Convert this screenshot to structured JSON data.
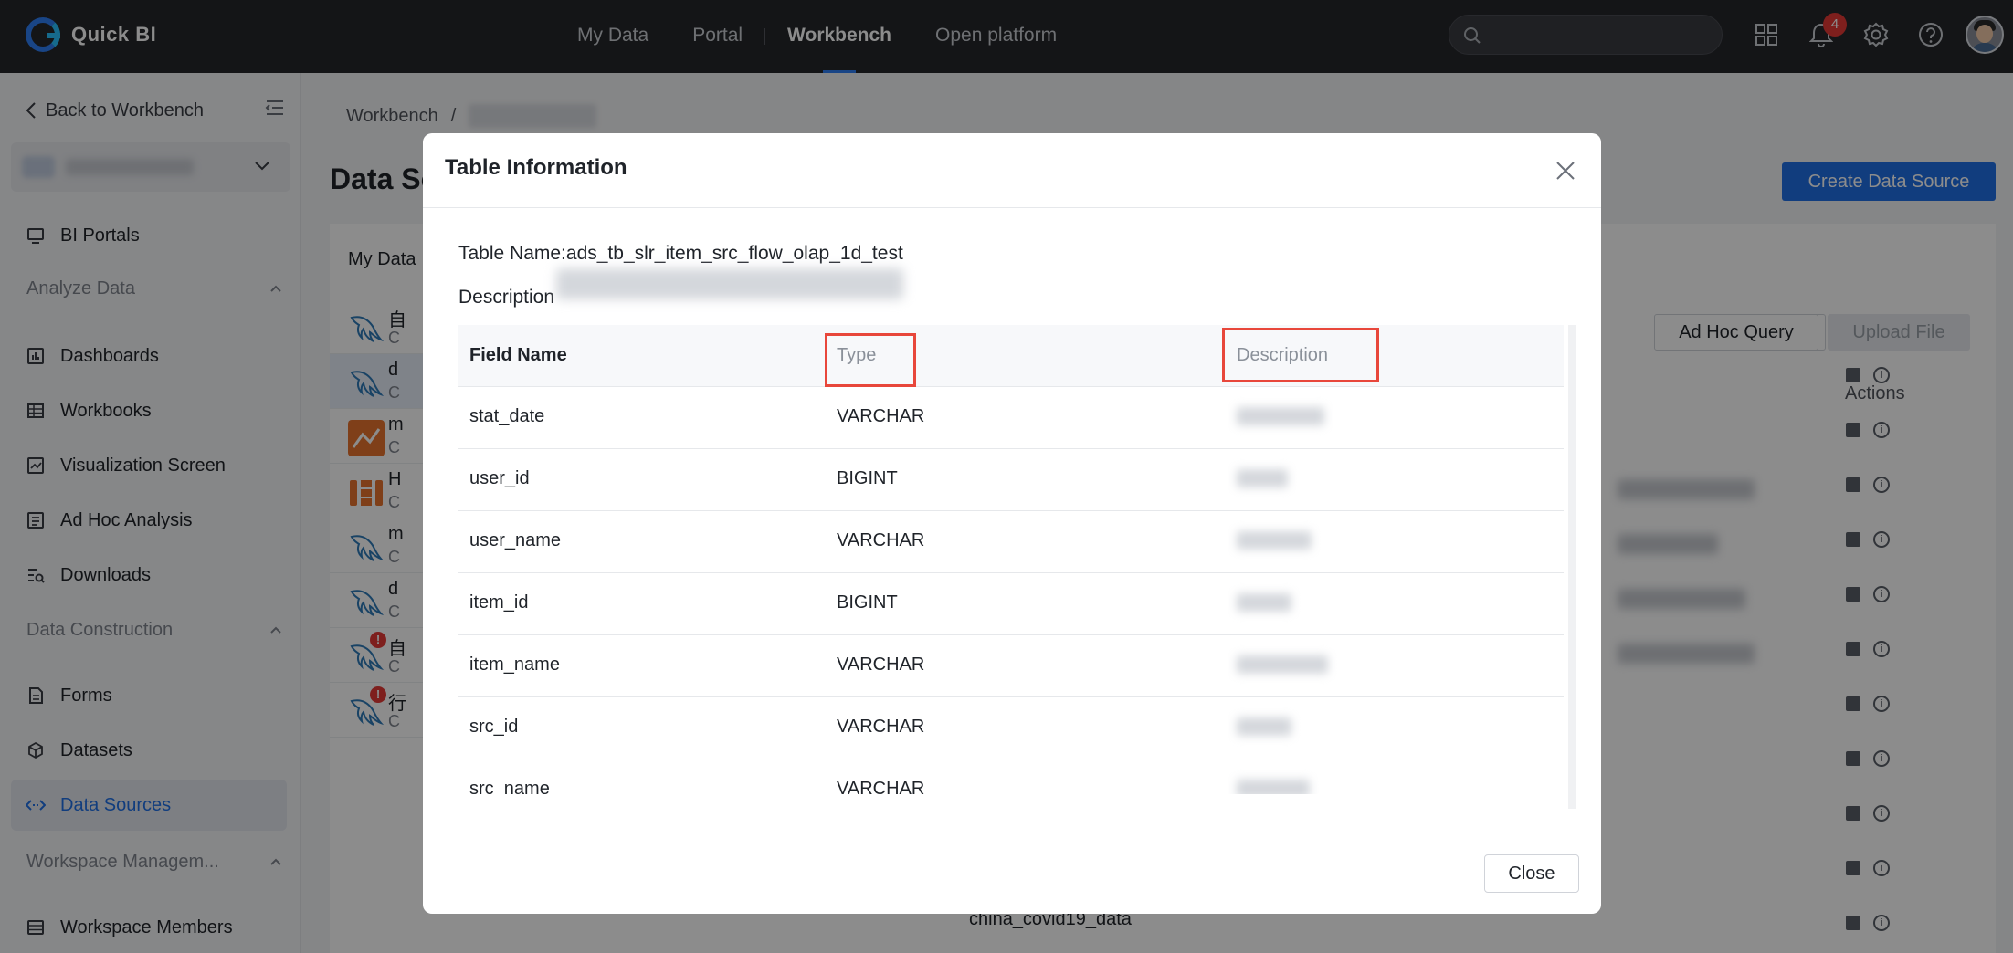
{
  "topbar": {
    "app_name": "Quick BI",
    "nav": [
      "My Data",
      "Portal",
      "Workbench",
      "Open platform"
    ],
    "active_nav": "Workbench",
    "notifications_count": "4",
    "accent_color": "#2f7ef5"
  },
  "sidebar": {
    "back_label": "Back to Workbench",
    "items": {
      "bi_portals": "BI Portals",
      "analyze_group": "Analyze Data",
      "dashboards": "Dashboards",
      "workbooks": "Workbooks",
      "visualization_screen": "Visualization Screen",
      "ad_hoc_analysis": "Ad Hoc Analysis",
      "downloads": "Downloads",
      "construction_group": "Data Construction",
      "forms": "Forms",
      "datasets": "Datasets",
      "data_sources": "Data Sources",
      "workspace_group": "Workspace Managem...",
      "workspace_members": "Workspace Members"
    }
  },
  "page": {
    "breadcrumb_root": "Workbench",
    "breadcrumb_sep": "/",
    "title": "Data So",
    "create_button": "Create Data Source",
    "tab_mydata": "My Data",
    "ad_hoc_query": "Ad Hoc Query",
    "upload_file": "Upload File",
    "actions_header": "Actions",
    "sources": [
      {
        "name": "自",
        "sub": "C"
      },
      {
        "name": "d",
        "sub": "C"
      },
      {
        "name": "m",
        "sub": "C"
      },
      {
        "name": "H",
        "sub": "C"
      },
      {
        "name": "m",
        "sub": "C"
      },
      {
        "name": "d",
        "sub": "C"
      },
      {
        "name": "自",
        "sub": "C"
      },
      {
        "name": "行",
        "sub": "C"
      }
    ],
    "last_table_name": "china_covid19_data"
  },
  "modal": {
    "title": "Table Information",
    "table_name_line": "Table Name:ads_tb_slr_item_src_flow_olap_1d_test",
    "description_label": "Description",
    "columns": {
      "field_name": "Field Name",
      "type": "Type",
      "description": "Description"
    },
    "rows": [
      {
        "field": "stat_date",
        "type": "VARCHAR"
      },
      {
        "field": "user_id",
        "type": "BIGINT"
      },
      {
        "field": "user_name",
        "type": "VARCHAR"
      },
      {
        "field": "item_id",
        "type": "BIGINT"
      },
      {
        "field": "item_name",
        "type": "VARCHAR"
      },
      {
        "field": "src_id",
        "type": "VARCHAR"
      },
      {
        "field": "src_name",
        "type": "VARCHAR"
      }
    ],
    "close_button": "Close",
    "highlight_color": "#e8473b"
  }
}
